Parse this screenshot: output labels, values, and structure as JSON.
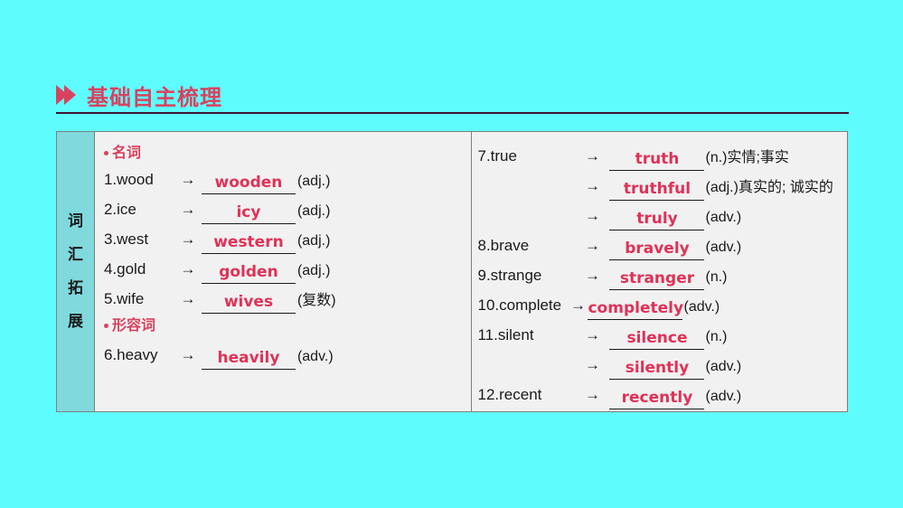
{
  "heading": {
    "icon": "double-chevron-right-icon",
    "title": "基础自主梳理",
    "accent_color": "#d8425f",
    "rule_color": "#3f1430"
  },
  "page": {
    "background_color": "#5ffcfd",
    "table_background_color": "#f1f1f1",
    "sidebar_color": "#7fd9dd",
    "answer_color": "#df3257"
  },
  "sidebar": {
    "characters": [
      "词",
      "汇",
      "拓",
      "展"
    ]
  },
  "left_column": {
    "groups": [
      {
        "label": "名词",
        "items": [
          {
            "num": "1.",
            "term": "wood",
            "arrow": "→",
            "answer": "wooden",
            "pos": "(adj.)"
          },
          {
            "num": "2.",
            "term": "ice",
            "arrow": "→",
            "answer": "icy",
            "pos": "(adj.)"
          },
          {
            "num": "3.",
            "term": "west",
            "arrow": "→",
            "answer": "western",
            "pos": "(adj.)"
          },
          {
            "num": "4.",
            "term": "gold",
            "arrow": "→",
            "answer": "golden",
            "pos": "(adj.)"
          },
          {
            "num": "5.",
            "term": "wife",
            "arrow": "→",
            "answer": "wives",
            "pos": "(复数)"
          }
        ]
      },
      {
        "label": "形容词",
        "items": [
          {
            "num": "6.",
            "term": "heavy",
            "arrow": "→",
            "answer": "heavily",
            "pos": "(adv.)"
          }
        ]
      }
    ]
  },
  "right_column": {
    "items": [
      {
        "num": "7.",
        "term": "true",
        "arrow": "→",
        "answer": "truth",
        "pos": "(n.)实情;事实"
      },
      {
        "num": "",
        "term": "",
        "arrow": "→",
        "answer": "truthful",
        "pos": "(adj.)真实的; 诚实的"
      },
      {
        "num": "",
        "term": "",
        "arrow": "→",
        "answer": "truly",
        "pos": "(adv.)"
      },
      {
        "num": "8.",
        "term": "brave",
        "arrow": "→",
        "answer": "bravely",
        "pos": "(adv.)"
      },
      {
        "num": "9.",
        "term": "strange",
        "arrow": "→",
        "answer": "stranger",
        "pos": "(n.)"
      },
      {
        "num": "10.",
        "term": "complete",
        "arrow": "→",
        "answer": "completely",
        "pos": "(adv.)"
      },
      {
        "num": "11.",
        "term": "silent",
        "arrow": "→",
        "answer": "silence",
        "pos": "(n.)"
      },
      {
        "num": "",
        "term": "",
        "arrow": "→",
        "answer": "silently",
        "pos": "(adv.)"
      },
      {
        "num": "12.",
        "term": "recent",
        "arrow": "→",
        "answer": "recently",
        "pos": "(adv.)"
      }
    ]
  }
}
